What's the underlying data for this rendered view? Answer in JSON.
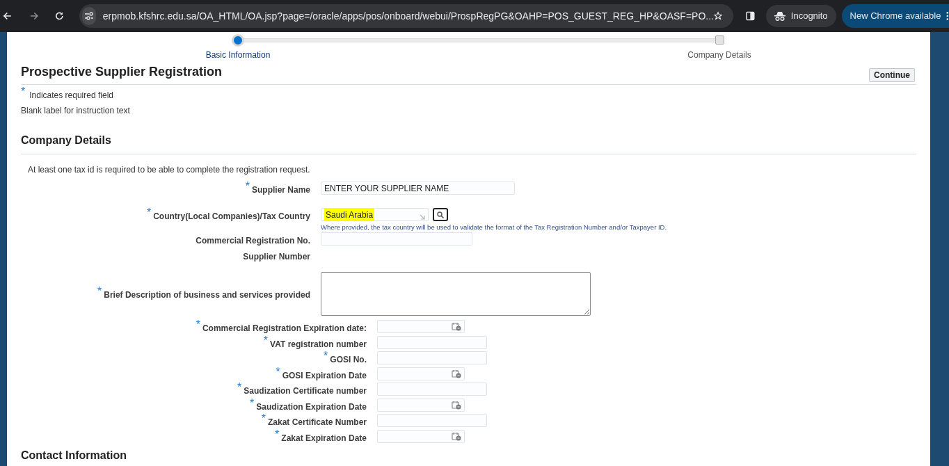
{
  "browser": {
    "url": "erpmob.kfshrc.edu.sa/OA_HTML/OA.jsp?page=/oracle/apps/pos/onboard/webui/ProspRegPG&OAHP=POS_GUEST_REG_HP&OASF=PO...",
    "profile": "Incognito",
    "update_button": "New Chrome available"
  },
  "train": [
    {
      "label": "Basic Information",
      "selected": true
    },
    {
      "label": "Company Details",
      "selected": false
    }
  ],
  "page_title": "Prospective Supplier Registration",
  "continue_button": "Continue",
  "required_legend": {
    "mark": "*",
    "text": "Indicates required field"
  },
  "instruction": "Blank label for instruction text",
  "section": {
    "title": "Company Details",
    "note": "At least one tax id is required to be able to complete the registration request.",
    "fields_primary": [
      {
        "label": "Supplier Name",
        "required": true,
        "kind": "text",
        "value": "ENTER YOUR SUPPLIER NAME"
      },
      {
        "label": "Country(Local Companies)/Tax Country",
        "required": true,
        "kind": "lov",
        "value": "Saudi Arabia",
        "highlighted": true,
        "hint": "Where provided, the tax country will be used to validate the format of the Tax Registration Number and/or Taxpayer ID."
      },
      {
        "label": "Commercial Registration No.",
        "required": false,
        "kind": "text_short"
      },
      {
        "label": "Supplier Number",
        "required": false,
        "kind": "display"
      },
      {
        "label": "Brief Description of business and services provided",
        "required": true,
        "kind": "textarea"
      }
    ],
    "fields_secondary": [
      {
        "label": "Commercial Registration Expiration date:",
        "required": true,
        "kind": "date"
      },
      {
        "label": "VAT registration number",
        "required": true,
        "kind": "text"
      },
      {
        "label": "GOSI No.",
        "required": true,
        "kind": "text"
      },
      {
        "label": "GOSI Expiration Date",
        "required": true,
        "kind": "date"
      },
      {
        "label": "Saudization Certificate number",
        "required": true,
        "kind": "text"
      },
      {
        "label": "Saudization Expiration Date",
        "required": true,
        "kind": "date"
      },
      {
        "label": "Zakat Certificate Number",
        "required": true,
        "kind": "text"
      },
      {
        "label": "Zakat Expiration Date",
        "required": true,
        "kind": "date"
      }
    ]
  },
  "next_section": {
    "title": "Contact Information"
  }
}
